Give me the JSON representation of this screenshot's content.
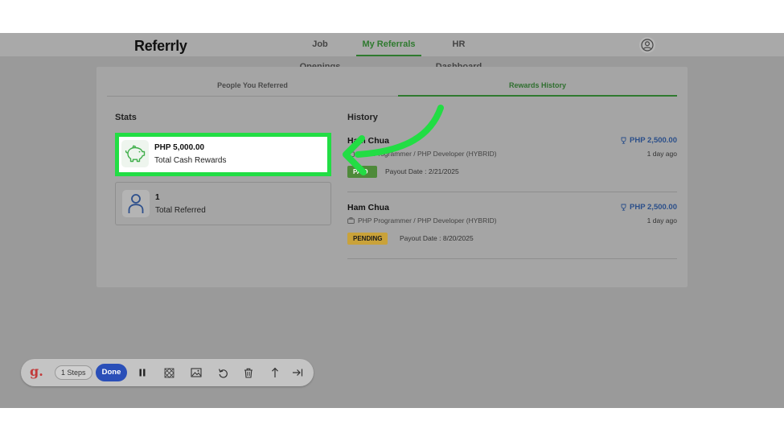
{
  "app": {
    "logo": "Referrly"
  },
  "nav": {
    "items": [
      {
        "label": "Job Openings"
      },
      {
        "label": "My Referrals"
      },
      {
        "label": "HR Dashboard"
      }
    ]
  },
  "tabs": [
    {
      "label": "People You Referred"
    },
    {
      "label": "Rewards History"
    }
  ],
  "stats": {
    "title": "Stats",
    "items": [
      {
        "value": "PHP 5,000.00",
        "label": "Total Cash Rewards",
        "icon": "piggy-bank-icon"
      },
      {
        "value": "1",
        "label": "Total Referred",
        "icon": "user-icon"
      }
    ]
  },
  "history": {
    "title": "History",
    "items": [
      {
        "name": "Ham Chua",
        "job": "PHP Programmer / PHP Developer (HYBRID)",
        "amount": "PHP 2,500.00",
        "time": "1 day ago",
        "badge": "PAID",
        "payout": "Payout Date : 2/21/2025"
      },
      {
        "name": "Ham Chua",
        "job": "PHP Programmer / PHP Developer (HYBRID)",
        "amount": "PHP 2,500.00",
        "time": "1 day ago",
        "badge": "PENDING",
        "payout": "Payout Date : 8/20/2025"
      }
    ]
  },
  "toolbar": {
    "logo": "g.",
    "steps": "1 Steps",
    "done": "Done",
    "icons": [
      "pause-icon",
      "blur-icon",
      "image-icon",
      "undo-icon",
      "trash-icon",
      "upload-icon",
      "skip-end-icon"
    ]
  },
  "colors": {
    "accent_green": "#2f7a2f",
    "highlight_green": "#22dd44",
    "amount_blue": "#2b4f8a",
    "paid_green": "#4e8a3a",
    "pending_gold": "#c9a23a",
    "done_blue": "#2a4fb8"
  }
}
